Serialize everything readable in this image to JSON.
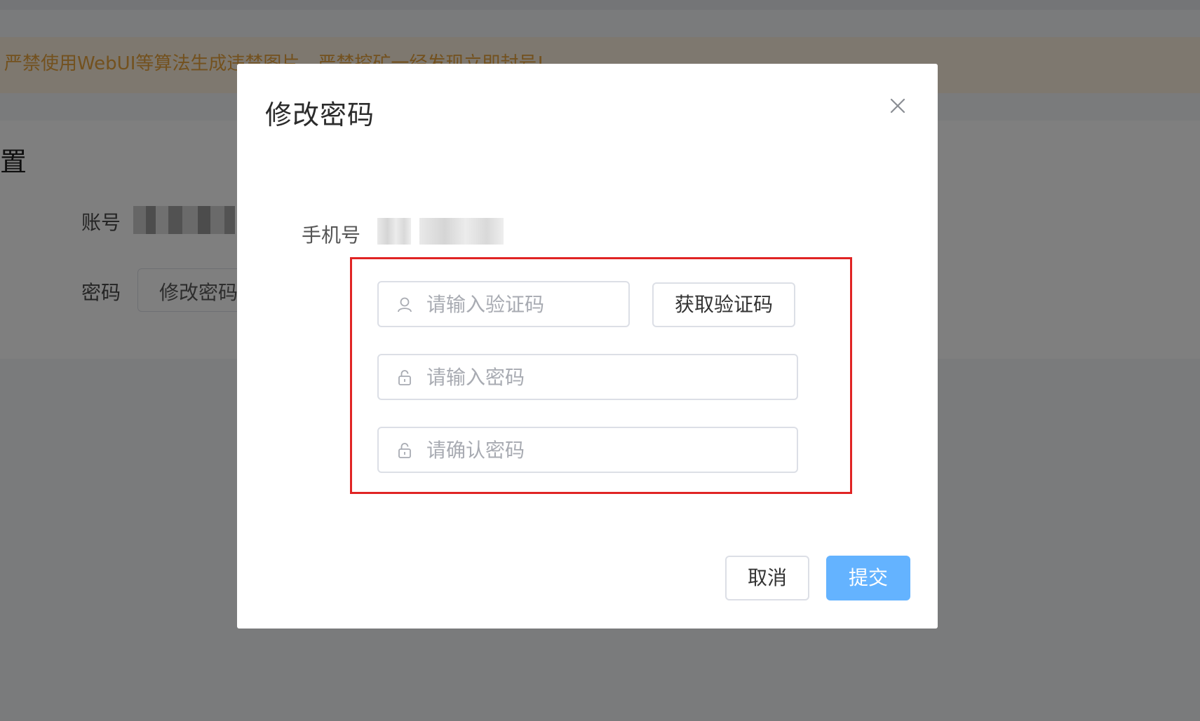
{
  "background": {
    "notice": "严禁使用WebUI等算法生成违禁图片，严禁挖矿一经发现立即封号!",
    "section_title": "置",
    "account_label": "账号",
    "password_label": "密码",
    "change_password_button": "修改密码"
  },
  "dialog": {
    "title": "修改密码",
    "close_icon": "close-icon",
    "phone_label": "手机号",
    "phone_value": "",
    "verification_code": {
      "placeholder": "请输入验证码",
      "value": "",
      "icon": "user-icon"
    },
    "get_code_button": "获取验证码",
    "new_password": {
      "placeholder": "请输入密码",
      "value": "",
      "icon": "lock-icon"
    },
    "confirm_password": {
      "placeholder": "请确认密码",
      "value": "",
      "icon": "lock-icon"
    },
    "cancel_button": "取消",
    "submit_button": "提交"
  },
  "colors": {
    "primary": "#64b3ff",
    "highlight_border": "#e02424",
    "notice_text": "#e6a23c",
    "notice_background": "#fdf1de"
  }
}
